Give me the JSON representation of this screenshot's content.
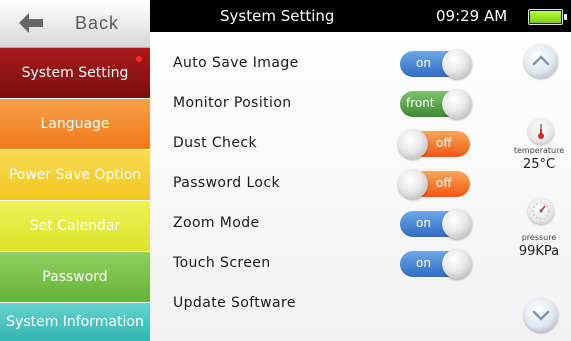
{
  "header": {
    "title": "System Setting",
    "time": "09:29 AM",
    "battery_level": 1.0
  },
  "back": {
    "label": "Back"
  },
  "sidebar": {
    "items": [
      {
        "label": "System Setting",
        "color": "#8f1414",
        "active": true
      },
      {
        "label": "Language",
        "color": "#f58a2d"
      },
      {
        "label": "Power Save Option",
        "color": "#f5d238"
      },
      {
        "label": "Set Calendar",
        "color": "#e8ee3a"
      },
      {
        "label": "Password",
        "color": "#79c54a"
      },
      {
        "label": "System Information",
        "color": "#4ec6c2"
      }
    ]
  },
  "settings": [
    {
      "label": "Auto Save Image",
      "toggle": "on"
    },
    {
      "label": "Monitor Position",
      "toggle": "front"
    },
    {
      "label": "Dust Check",
      "toggle": "off"
    },
    {
      "label": "Password Lock",
      "toggle": "off"
    },
    {
      "label": "Zoom Mode",
      "toggle": "on"
    },
    {
      "label": "Touch Screen",
      "toggle": "on"
    },
    {
      "label": "Update Software"
    }
  ],
  "sensors": {
    "temperature_label": "temperature",
    "temperature_value": "25°C",
    "pressure_label": "pressure",
    "pressure_value": "99KPa"
  },
  "icons": {
    "back": "back-arrow-icon",
    "scroll_up": "chevron-up-icon",
    "scroll_down": "chevron-down-icon",
    "thermometer": "thermometer-icon",
    "pressure": "pressure-gauge-icon",
    "battery": "battery-icon"
  }
}
